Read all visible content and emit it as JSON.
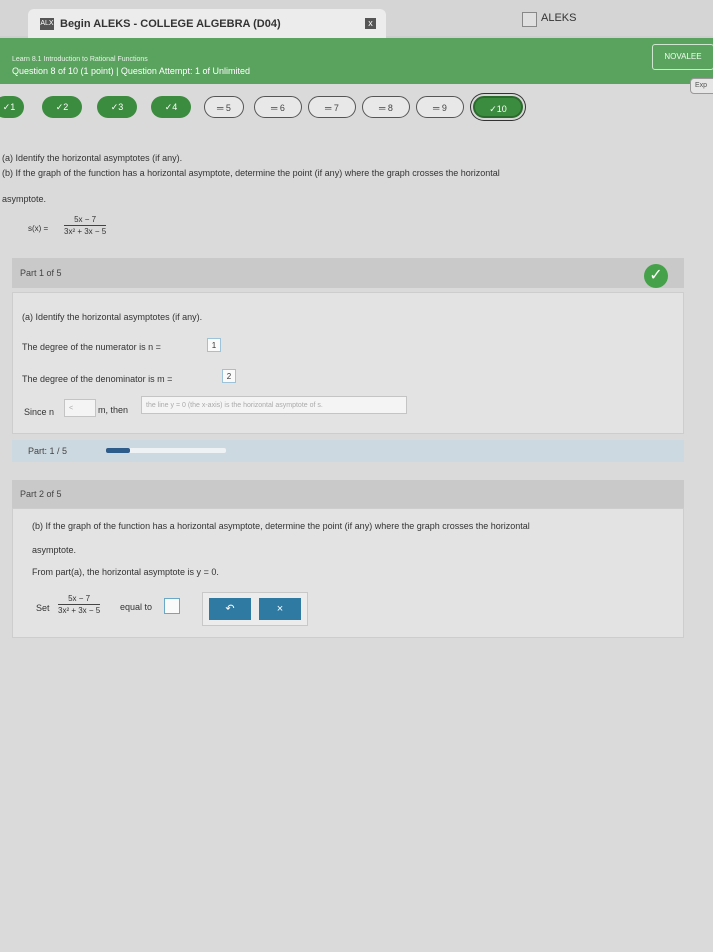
{
  "browser": {
    "tab_favicon": "ALX",
    "tab_title": "Begin ALEKS - COLLEGE ALGEBRA (D04)",
    "tab_close": "x",
    "tab2_title": "ALEKS"
  },
  "header": {
    "topic": "Learn 8.1 Introduction to Rational Functions",
    "question_info": "Question 8 of 10 (1 point)  |  Question Attempt: 1 of Unlimited",
    "user": "NOVALEE",
    "exit": "Exp"
  },
  "question_nav": [
    {
      "label": "✓1",
      "status": "done"
    },
    {
      "label": "✓2",
      "status": "done"
    },
    {
      "label": "✓3",
      "status": "done"
    },
    {
      "label": "✓4",
      "status": "done"
    },
    {
      "label": "═ 5",
      "status": "pending"
    },
    {
      "label": "═ 6",
      "status": "pending"
    },
    {
      "label": "═ 7",
      "status": "pending"
    },
    {
      "label": "═ 8",
      "status": "pending"
    },
    {
      "label": "═ 9",
      "status": "pending"
    },
    {
      "label": "✓10",
      "status": "done"
    }
  ],
  "problem": {
    "line_a": "(a) Identify the horizontal asymptotes (if any).",
    "line_b1": "(b) If the graph of the function has a horizontal asymptote, determine the point (if any) where the graph crosses the horizontal",
    "line_b2": "asymptote.",
    "fn_lhs": "s(x) =",
    "fn_num": "5x − 7",
    "fn_den": "3x² + 3x − 5"
  },
  "part1": {
    "header": "Part 1 of 5",
    "check": "✓",
    "prompt": "(a) Identify the horizontal asymptotes (if any).",
    "numerator_text": "The degree of the numerator is n =",
    "numerator_value": "1",
    "denominator_text": "The degree of the denominator is m =",
    "denominator_value": "2",
    "since_text": "Since n",
    "since_select": "<",
    "m_then": "m, then",
    "conclusion_select": "the line y = 0 (the x-axis) is the horizontal asymptote of s."
  },
  "progress": {
    "label": "Part: 1 / 5",
    "fraction": 0.2
  },
  "part2": {
    "header": "Part 2 of 5",
    "prompt1": "(b) If the graph of the function has a horizontal asymptote, determine the point (if any) where the graph crosses the horizontal",
    "prompt2": "asymptote.",
    "from_text": "From part(a), the horizontal asymptote is y = 0.",
    "set_text": "Set",
    "frac_num": "5x − 7",
    "frac_den": "3x² + 3x − 5",
    "equal_text": "equal to",
    "undo_label": "↶",
    "clear_label": "×"
  },
  "colors": {
    "header_green": "#5aa35f",
    "check_green": "#46a24a",
    "keypad_blue": "#2f7aa3"
  }
}
